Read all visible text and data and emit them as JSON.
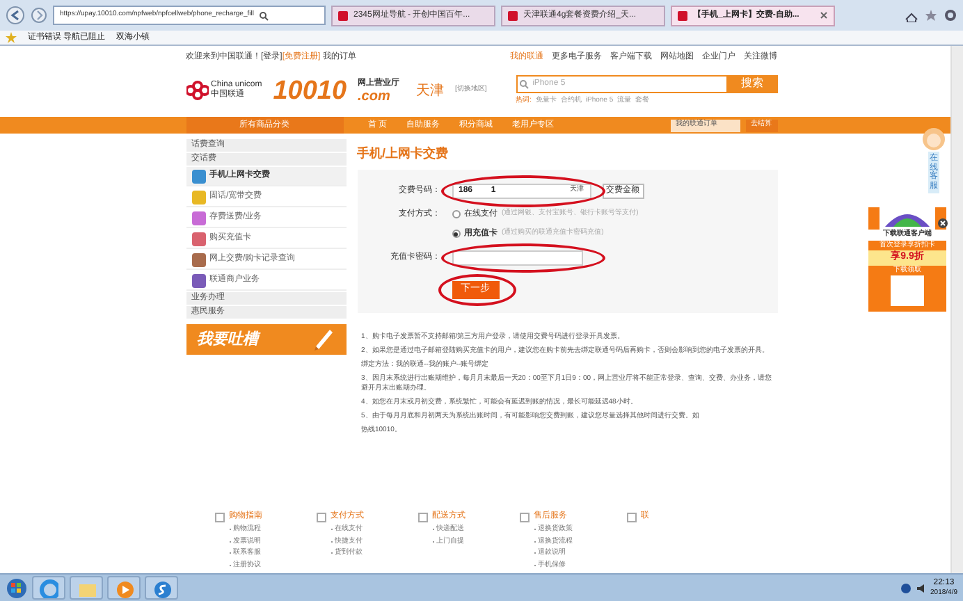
{
  "browser": {
    "url": "https://upay.10010.com/npfweb/npfcellweb/phone_recharge_fill",
    "tabs": [
      {
        "label": "2345网址导航 - 开创中国百年...",
        "selected": false
      },
      {
        "label": "天津联通4g套餐资费介绍_天...",
        "selected": false
      },
      {
        "label": "【手机_上网卡】交费-自助...",
        "selected": true
      }
    ],
    "favorites": [
      "证书错误 导航已阻止",
      "双海小镇"
    ]
  },
  "top_bar": {
    "welcome": "欢迎来到中国联通！",
    "login": "[登录]",
    "register": "[免费注册]",
    "orders": "我的订单",
    "links": [
      "我的联通",
      "更多电子服务",
      "客户端下载",
      "网站地图",
      "企业门户",
      "关注微博"
    ]
  },
  "header": {
    "logo_en": "China unicom",
    "logo_cn": "中国联通",
    "brand": "10010",
    "brand_sub": "网上营业厅",
    "brand_domain": ".com",
    "city": "天津",
    "city_switch": "[切换地区]",
    "search": {
      "placeholder": "iPhone 5",
      "button": "搜索"
    },
    "hot_words": [
      "热词:",
      "免量卡",
      "合约机",
      "iPhone 5",
      "流量",
      "套餐"
    ]
  },
  "nav": {
    "category": "所有商品分类",
    "items": [
      {
        "label": "首 页",
        "selected": false
      },
      {
        "label": "自助服务",
        "selected": false
      },
      {
        "label": "积分商城",
        "selected": false
      },
      {
        "label": "老用户专区",
        "selected": false
      }
    ],
    "dropdown": "我的联通订单",
    "cart": "去结算"
  },
  "sidebar": {
    "sections": [
      {
        "title": "话费查询"
      },
      {
        "title": "交话费",
        "children": [
          {
            "label": "手机/上网卡交费",
            "selected": true,
            "color": "#3a8fd0"
          },
          {
            "label": "固话/宽带交费",
            "selected": false,
            "color": "#e8b824"
          },
          {
            "label": "存费送费/业务",
            "selected": false,
            "color": "#c86bd6"
          },
          {
            "label": "购买充值卡",
            "selected": false,
            "color": "#d9626e"
          },
          {
            "label": "网上交费/购卡记录查询",
            "selected": false,
            "color": "#a86b4c"
          },
          {
            "label": "联通商户业务",
            "selected": false,
            "color": "#7a5bb8"
          }
        ]
      },
      {
        "title": "业务办理"
      },
      {
        "title": "惠民服务"
      }
    ],
    "banner": "我要吐槽"
  },
  "main": {
    "title": "手机/上网卡交费",
    "form": {
      "number_label": "交费号码：",
      "number_value": "186        1",
      "number_suffix": "天津",
      "amount_button": "交费金额",
      "pay_label": "支付方式：",
      "options": [
        {
          "label": "在线支付",
          "hint": "(通过网银、支付宝账号、银行卡账号等支付)",
          "selected": false
        },
        {
          "label": "用充值卡",
          "hint": "(通过购买的联通充值卡密码充值)",
          "selected": true
        }
      ],
      "card_label": "充值卡密码：",
      "next_button": "下一步"
    },
    "notes": [
      "1、购卡电子发票暂不支持邮箱/第三方用户登录，请使用交费号码进行登录开具发票。",
      "2、如果您是通过电子邮箱登陆购买充值卡的用户，建议您在购卡前先去绑定联通号码后再购卡，否则会影响到您的电子发票的开具。",
      "绑定方法：我的联通--我的账户--账号绑定",
      "3、因月末系统进行出账期维护，每月月末最后一天20：00至下月1日9：00，网上营业厅将不能正常登录、查询、交费、办业务，请您避开月末出账期办理。",
      "4、如您在月末或月初交费，系统繁忙，可能会有延迟到账的情况，最长可能延迟48小时。",
      "5、由于每月月底和月初两天为系统出账时间，有可能影响您交费到账，建议您尽量选择其他时间进行交费。如",
      "热线10010。"
    ]
  },
  "footer": {
    "columns": [
      {
        "title": "购物指南",
        "items": [
          "购物流程",
          "发票说明",
          "联系客服",
          "注册协议"
        ]
      },
      {
        "title": "支付方式",
        "items": [
          "在线支付",
          "快捷支付",
          "货到付款"
        ]
      },
      {
        "title": "配送方式",
        "items": [
          "快递配送",
          "上门自提"
        ]
      },
      {
        "title": "售后服务",
        "items": [
          "退换货政策",
          "退换货流程",
          "退款说明",
          "手机保修"
        ]
      },
      {
        "title": "联"
      }
    ]
  },
  "float": {
    "service": "在线客服",
    "ad_title": "下载联通客户端",
    "ad_line": "首次登录享折扣卡",
    "ad_discount": "享9.9折",
    "ad_action": "下载领取"
  },
  "taskbar": {
    "time": "22:13",
    "date": "2018/4/9"
  }
}
